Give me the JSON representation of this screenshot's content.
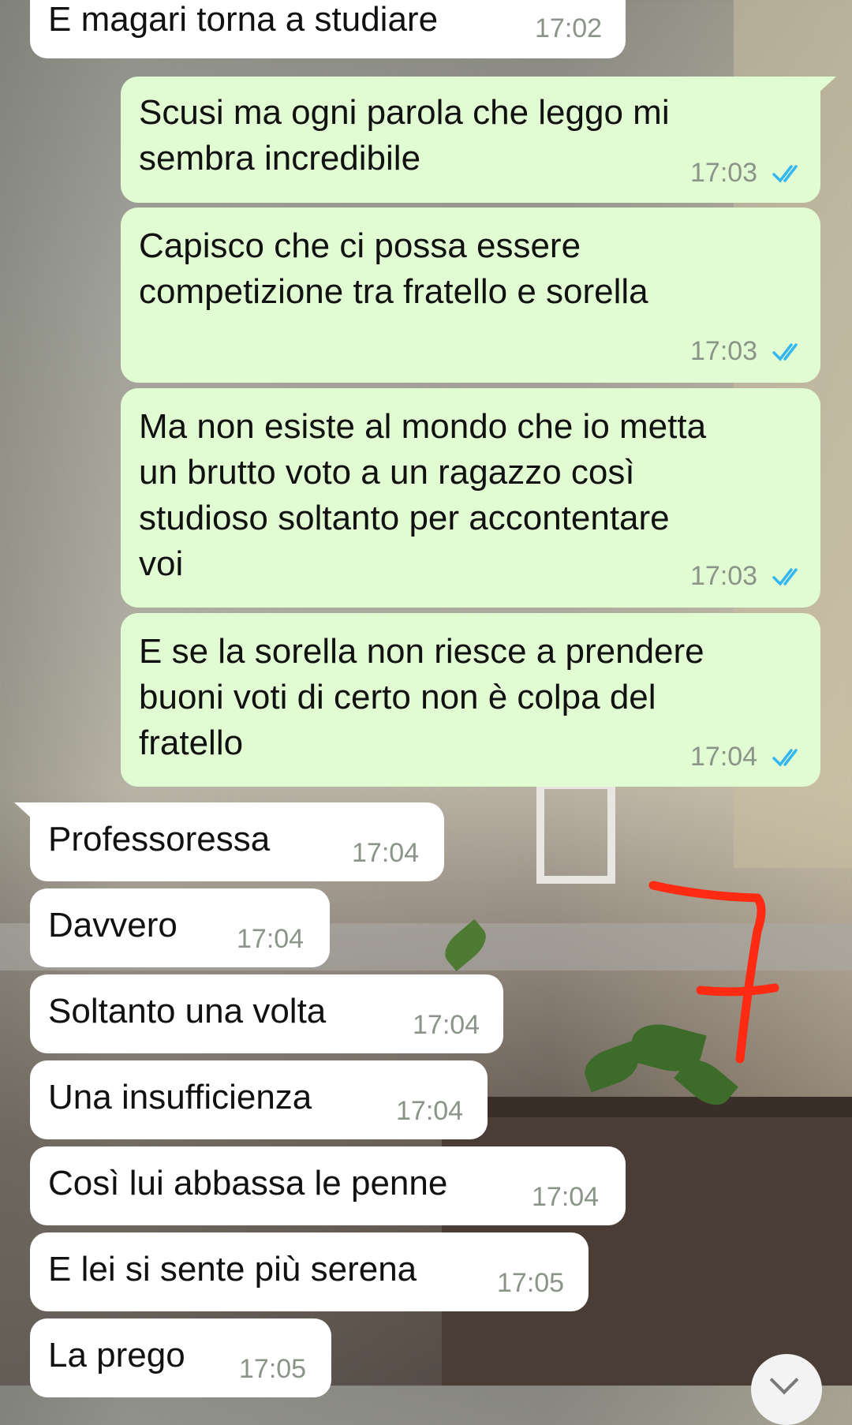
{
  "chat": {
    "messages": [
      {
        "text": "E magari torna a studiare",
        "time": "17:02",
        "direction": "in"
      },
      {
        "text": "Scusi ma ogni parola che leggo mi\nsembra incredibile",
        "time": "17:03",
        "direction": "out",
        "status": "read"
      },
      {
        "text": "Capisco che ci possa essere\ncompetizione tra fratello e sorella",
        "time": "17:03",
        "direction": "out",
        "status": "read"
      },
      {
        "text": "Ma non esiste al mondo che io metta\nun brutto voto a un ragazzo così\nstudioso soltanto per accontentare\nvoi",
        "time": "17:03",
        "direction": "out",
        "status": "read"
      },
      {
        "text": "E se la sorella non riesce a prendere\nbuoni voti di certo non è colpa del\nfratello",
        "time": "17:04",
        "direction": "out",
        "status": "read"
      },
      {
        "text": "Professoressa",
        "time": "17:04",
        "direction": "in"
      },
      {
        "text": "Davvero",
        "time": "17:04",
        "direction": "in"
      },
      {
        "text": "Soltanto una volta",
        "time": "17:04",
        "direction": "in"
      },
      {
        "text": "Una insufficienza",
        "time": "17:04",
        "direction": "in"
      },
      {
        "text": "Così lui abbassa le penne",
        "time": "17:04",
        "direction": "in"
      },
      {
        "text": "E lei si sente più serena",
        "time": "17:05",
        "direction": "in"
      },
      {
        "text": "La prego",
        "time": "17:05",
        "direction": "in"
      }
    ]
  },
  "colors": {
    "incoming_bubble": "#ffffff",
    "outgoing_bubble": "#e1fbd3",
    "read_ticks": "#34b7f1",
    "annotation": "#ff2a12"
  },
  "icons": {
    "read_status": "double-check-icon",
    "scroll_down": "chevron-down-icon"
  }
}
